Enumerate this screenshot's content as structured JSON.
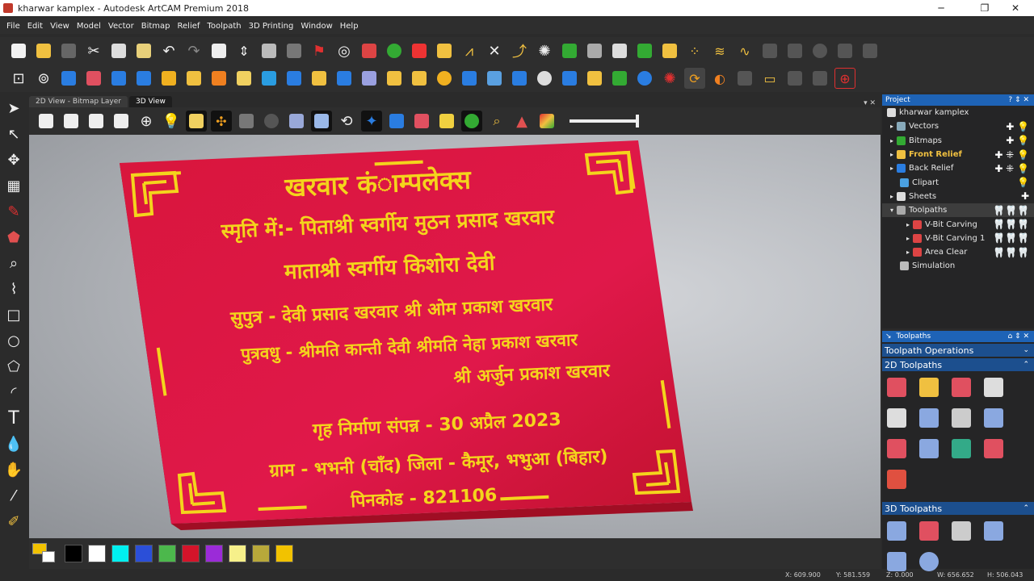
{
  "window": {
    "title": "kharwar kamplex - Autodesk ArtCAM Premium 2018"
  },
  "menu": [
    "File",
    "Edit",
    "View",
    "Model",
    "Vector",
    "Bitmap",
    "Relief",
    "Toolpath",
    "3D Printing",
    "Window",
    "Help"
  ],
  "view_tabs": [
    "2D View - Bitmap Layer",
    "3D View"
  ],
  "plaque": {
    "lines": [
      "खरवार कंाम्पलेक्स",
      "स्मृति में:- पिताश्री स्वर्गीय मुठन प्रसाद खरवार",
      "माताश्री स्वर्गीय किशोरा देवी",
      "सुपुत्र - देवी प्रसाद खरवार   श्री ओम प्रकाश खरवार",
      "पुत्रवधु - श्रीमति कान्ती देवी  श्रीमति नेहा प्रकाश खरवार",
      "श्री अर्जुन प्रकाश खरवार",
      "गृह निर्माण संपन्न - 30 अप्रैल 2023",
      "ग्राम - भभनी (चाँद)  जिला - कैमूर, भभुआ (बिहार)",
      "पिनकोड - 821106"
    ]
  },
  "project": {
    "header": "Project",
    "root": "kharwar kamplex",
    "items": [
      "Vectors",
      "Bitmaps",
      "Front Relief",
      "Back Relief",
      "Clipart",
      "Sheets",
      "Toolpaths",
      "V-Bit Carving",
      "V-Bit Carving 1",
      "Area Clear",
      "Simulation"
    ]
  },
  "toolpaths_panel": {
    "header": "Toolpaths",
    "operations": "Toolpath Operations",
    "section_2d": "2D Toolpaths",
    "section_3d": "3D Toolpaths"
  },
  "status": {
    "x": "X: 609.900",
    "y": "Y: 581.559",
    "z": "Z: 0.000",
    "w": "W: 656.652",
    "h": "H: 506.043"
  },
  "colors": {
    "plaque_red": "#d4143a",
    "text_yellow": "#f4d41c",
    "panel_blue": "#1e63b6"
  },
  "palette": [
    "#f2c200",
    "#000000",
    "#ffffff",
    "#00f0f0",
    "#2b4fd8",
    "#4cb84c",
    "#d4142a",
    "#9b2bd8",
    "#f6f08a",
    "#b8a83a",
    "#f2c200"
  ]
}
